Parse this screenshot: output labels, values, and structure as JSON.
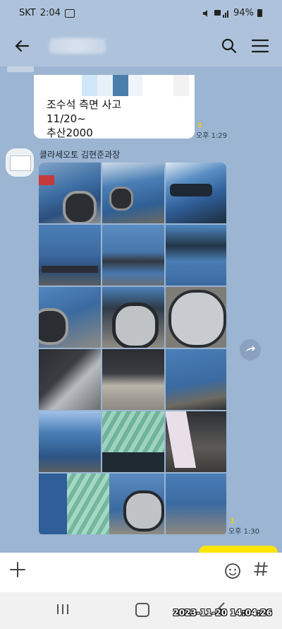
{
  "status": {
    "carrier": "SKT",
    "time": "2:04",
    "battery": "94%"
  },
  "message1": {
    "lines": [
      "조수석 측면 사고",
      "11/20~",
      "추산2000"
    ],
    "unread": "1",
    "time": "오후 1:29"
  },
  "message2": {
    "sender": "클라세오토 김현준과장",
    "unread": "1",
    "time": "오후 1:30",
    "photo_count": 17
  },
  "nav": {
    "timestamp": "2023-11-20 14:04:26"
  },
  "colors": {
    "chat_bg": "#9bb5d2",
    "header_bg": "#aec3db",
    "accent": "#fee500"
  },
  "icons": [
    "back-arrow-icon",
    "search-icon",
    "menu-icon",
    "plus-icon",
    "emoji-icon",
    "hash-icon",
    "share-icon"
  ]
}
